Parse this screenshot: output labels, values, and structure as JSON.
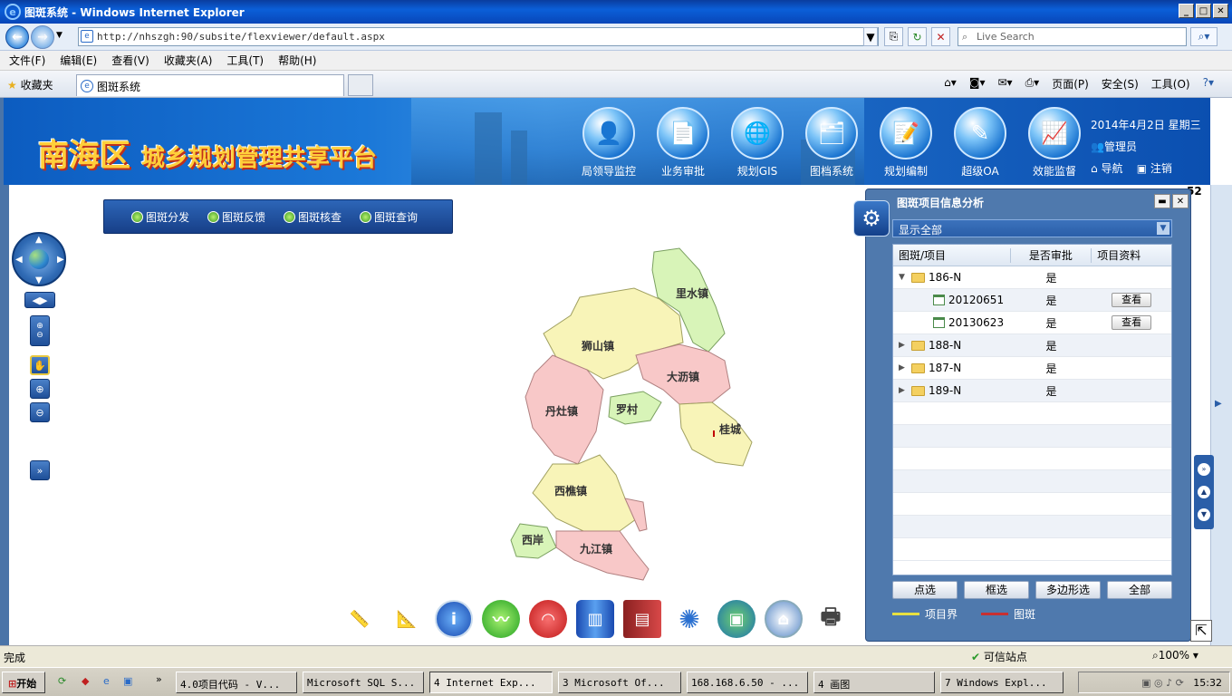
{
  "window": {
    "title": "图斑系统 - Windows Internet Explorer"
  },
  "address": {
    "url": "http://nhszgh:90/subsite/flexviewer/default.aspx",
    "search_placeholder": "Live Search"
  },
  "menu": [
    "文件(F)",
    "编辑(E)",
    "查看(V)",
    "收藏夹(A)",
    "工具(T)",
    "帮助(H)"
  ],
  "favorites": {
    "label": "收藏夹",
    "tab_title": "图斑系统"
  },
  "commands": [
    "页面(P)",
    "安全(S)",
    "工具(O)"
  ],
  "banner": {
    "title": "南海区",
    "subtitle": "城乡规划管理共享平台",
    "nav": [
      "局领导监控",
      "业务审批",
      "规划GIS",
      "图档系统",
      "规划编制",
      "超级OA",
      "效能监督"
    ],
    "date": "2014年4月2日 星期三",
    "user": "管理员",
    "nav_link": "导航",
    "logout": "注销"
  },
  "toolmenu": [
    "图斑分发",
    "图斑反馈",
    "图斑核查",
    "图斑查询"
  ],
  "map": {
    "regions": [
      "里水镇",
      "狮山镇",
      "大沥镇",
      "丹灶镇",
      "罗村",
      "桂城",
      "西樵镇",
      "西岸",
      "九江镇"
    ],
    "fragment": "52"
  },
  "panel": {
    "title": "图斑项目信息分析",
    "filter": "显示全部",
    "columns": [
      "图斑/项目",
      "是否审批",
      "项目资料"
    ],
    "rows": [
      {
        "id": "186-N",
        "approved": "是",
        "expanded": true,
        "children": [
          {
            "id": "20120651",
            "approved": "是",
            "action": "查看"
          },
          {
            "id": "20130623",
            "approved": "是",
            "action": "查看"
          }
        ]
      },
      {
        "id": "188-N",
        "approved": "是"
      },
      {
        "id": "187-N",
        "approved": "是"
      },
      {
        "id": "189-N",
        "approved": "是"
      }
    ],
    "buttons": [
      "点选",
      "框选",
      "多边形选",
      "全部"
    ],
    "legend": [
      {
        "label": "项目界",
        "color": "#e8e040"
      },
      {
        "label": "图斑",
        "color": "#c83030"
      }
    ]
  },
  "status": {
    "text": "完成",
    "trust": "可信站点",
    "zoom": "100%"
  },
  "taskbar": {
    "start": "开始",
    "items": [
      "4.0项目代码 - V...",
      "Microsoft SQL S...",
      "4 Internet Exp...",
      "3 Microsoft Of...",
      "168.168.6.50 - ...",
      "4 画图",
      "7 Windows Expl..."
    ],
    "time": "15:32"
  }
}
